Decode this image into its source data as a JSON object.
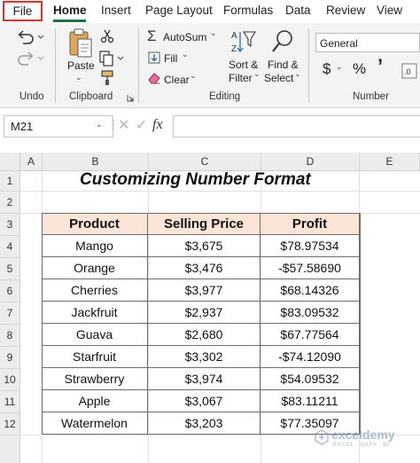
{
  "tabs": [
    {
      "key": "file",
      "label": "File"
    },
    {
      "key": "home",
      "label": "Home"
    },
    {
      "key": "insert",
      "label": "Insert"
    },
    {
      "key": "page_layout",
      "label": "Page Layout"
    },
    {
      "key": "formulas",
      "label": "Formulas"
    },
    {
      "key": "data",
      "label": "Data"
    },
    {
      "key": "review",
      "label": "Review"
    },
    {
      "key": "view",
      "label": "View"
    }
  ],
  "active_tab": "Home",
  "highlight_color": "#e0312d",
  "accent_color": "#217346",
  "ribbon": {
    "undo": {
      "group_label": "Undo",
      "undo_icon": "undo-icon",
      "redo_icon": "redo-icon"
    },
    "clipboard": {
      "group_label": "Clipboard",
      "paste_label": "Paste",
      "paste_icon": "paste-icon",
      "cut_icon": "scissors-icon",
      "copy_icon": "copy-icon",
      "format_painter_icon": "format-painter-icon",
      "dialog_launcher_icon": "dialog-launcher-icon"
    },
    "editing": {
      "group_label": "Editing",
      "autosum_label": "AutoSum",
      "fill_label": "Fill",
      "clear_label": "Clear",
      "sort_filter_label_1": "Sort &",
      "sort_filter_label_2": "Filter",
      "find_select_label_1": "Find &",
      "find_select_label_2": "Select"
    },
    "number": {
      "group_label": "Number",
      "format_value": "General",
      "currency_symbol": "$",
      "percent_symbol": "%",
      "comma_symbol": "’"
    }
  },
  "formula_bar": {
    "name_box": "M21",
    "fx_label": "fx",
    "formula": ""
  },
  "sheet": {
    "columns": [
      "A",
      "B",
      "C",
      "D",
      "E"
    ],
    "rows": [
      "1",
      "2",
      "3",
      "4",
      "5",
      "6",
      "7",
      "8",
      "9",
      "10",
      "11",
      "12"
    ],
    "title": "Customizing Number Format",
    "table": {
      "header_fill": "#fce4d6",
      "headers": [
        "Product",
        "Selling Price",
        "Profit"
      ],
      "rows": [
        [
          "Mango",
          "$3,675",
          "$78.97534"
        ],
        [
          "Orange",
          "$3,476",
          "-$57.58690"
        ],
        [
          "Cherries",
          "$3,977",
          "$68.14326"
        ],
        [
          "Jackfruit",
          "$2,937",
          "$83.09532"
        ],
        [
          "Guava",
          "$2,680",
          "$67.77564"
        ],
        [
          "Starfruit",
          "$3,302",
          "-$74.12090"
        ],
        [
          "Strawberry",
          "$3,974",
          "$54.09532"
        ],
        [
          "Apple",
          "$3,067",
          "$83.11211"
        ],
        [
          "Watermelon",
          "$3,203",
          "$77.35097"
        ]
      ]
    }
  },
  "watermark": {
    "name": "exceldemy",
    "subtitle": "EXCEL · DATA · BI"
  }
}
